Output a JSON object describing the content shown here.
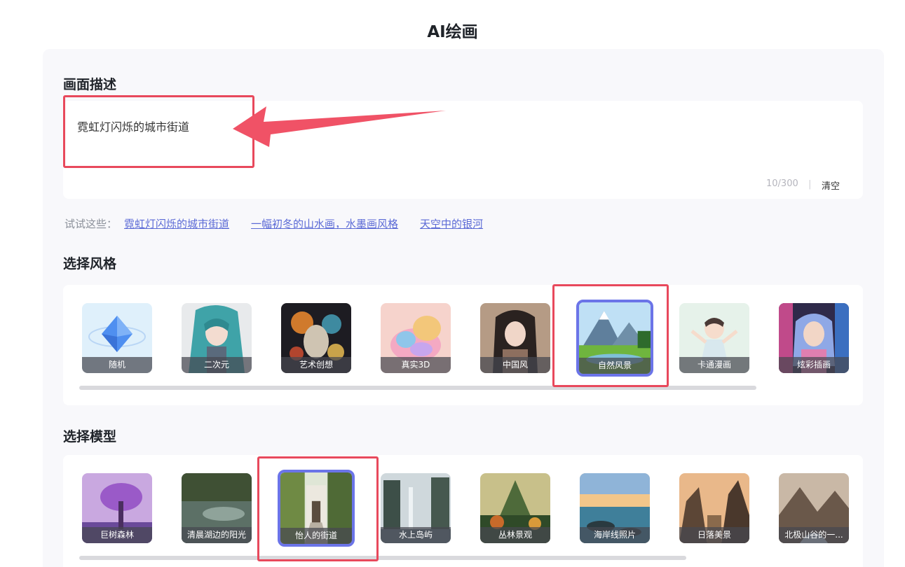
{
  "page": {
    "title": "AI绘画"
  },
  "prompt": {
    "section_title": "画面描述",
    "value": "霓虹灯闪烁的城市街道",
    "counter": "10/300",
    "divider": "|",
    "clear_label": "清空"
  },
  "suggestions": {
    "label": "试试这些：",
    "items": [
      "霓虹灯闪烁的城市街道",
      "一幅初冬的山水画，水墨画风格",
      "天空中的银河"
    ]
  },
  "styles": {
    "section_title": "选择风格",
    "selected": "自然风景",
    "items": [
      "随机",
      "二次元",
      "艺术创想",
      "真实3D",
      "中国风",
      "自然风景",
      "卡通漫画",
      "炫彩插画"
    ]
  },
  "models": {
    "section_title": "选择模型",
    "selected": "怡人的街道",
    "items": [
      "巨树森林",
      "清晨湖边的阳光",
      "怡人的街道",
      "水上岛屿",
      "丛林景观",
      "海岸线照片",
      "日落美景",
      "北极山谷的一..."
    ]
  },
  "colors": {
    "accent": "#6b74e8",
    "link": "#5b6ad6",
    "annotation": "#e8495c"
  }
}
